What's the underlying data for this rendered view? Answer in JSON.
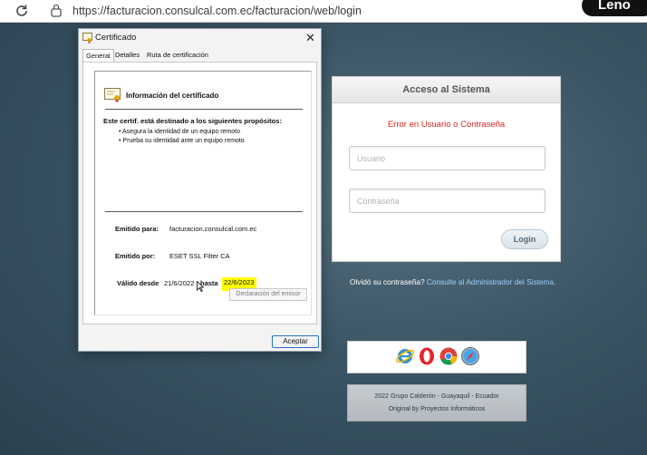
{
  "browser": {
    "url": "https://facturacion.consulcal.com.ec/facturacion/web/login",
    "brand": "Leno"
  },
  "dialog": {
    "title": "Certificado",
    "close_glyph": "✕",
    "tabs": [
      {
        "label": "General",
        "active": true
      },
      {
        "label": "Detalles",
        "active": false
      },
      {
        "label": "Ruta de certificación",
        "active": false
      }
    ],
    "info_title": "Información del certificado",
    "purpose_heading": "Este certif. está destinado a los siguientes propósitos:",
    "purposes": [
      "Asegura la identidad de un equipo remoto",
      "Prueba su identidad ante un equipo remoto"
    ],
    "issued_to_label": "Emitido para:",
    "issued_to_value": "facturacion.consulcal.com.ec",
    "issued_by_label": "Emitido por:",
    "issued_by_value": "ESET SSL Filter CA",
    "valid_from_label": "Válido desde",
    "valid_from_value": "21/6/2022",
    "valid_to_label": "hasta",
    "valid_to_value": "22/6/2023",
    "issuer_statement_button": "Declaración del emisor",
    "accept_button": "Aceptar"
  },
  "login": {
    "heading": "Acceso al Sistema",
    "error": "Error en Usuario o Contraseña",
    "user_placeholder": "Usuario",
    "password_placeholder": "Contraseña",
    "submit": "Login",
    "forgot_prefix": "Olvidó su contraseña?",
    "forgot_link": "Consulte al Administrador del Sistema."
  },
  "browsers_icons": [
    "internet-explorer-icon",
    "opera-icon",
    "chrome-icon",
    "safari-icon"
  ],
  "footer": {
    "line1": "2022  Grupo Calderón  -  Guayaquil - Ecuador",
    "line2": "Original by  Proyectos Informáticos"
  },
  "colors": {
    "error_red": "#d9251c",
    "highlight_yellow": "#ffff00",
    "link_blue": "#9fd0ff"
  }
}
